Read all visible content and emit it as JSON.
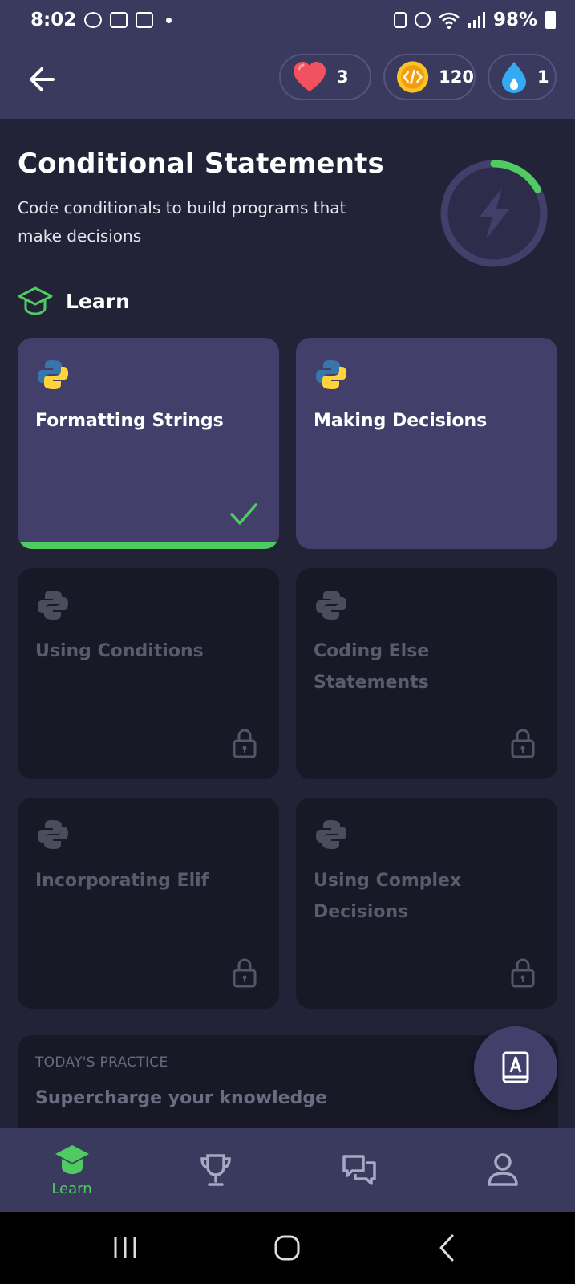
{
  "status_bar": {
    "time": "8:02",
    "battery": "98%"
  },
  "header": {
    "hearts": "3",
    "coins": "120",
    "streak": "1",
    "colors": {
      "heart": "#f2525f",
      "coin": "#f7c325",
      "streak": "#35a9f2"
    }
  },
  "course": {
    "title": "Conditional Statements",
    "description": "Code conditionals to build programs that make decisions",
    "progress_fraction": 0.17
  },
  "learn_section": {
    "label": "Learn"
  },
  "lessons": [
    {
      "title": "Formatting Strings",
      "state": "completed"
    },
    {
      "title": "Making Decisions",
      "state": "unlocked"
    },
    {
      "title": "Using Conditions",
      "state": "locked"
    },
    {
      "title": "Coding Else Statements",
      "state": "locked"
    },
    {
      "title": "Incorporating Elif",
      "state": "locked"
    },
    {
      "title": "Using Complex Decisions",
      "state": "locked"
    }
  ],
  "practice": {
    "label": "TODAY'S PRACTICE",
    "title": "Supercharge your knowledge"
  },
  "bottom_nav": {
    "items": [
      {
        "label": "Learn",
        "icon": "graduation-cap-icon",
        "active": true
      },
      {
        "label": "",
        "icon": "trophy-icon",
        "active": false
      },
      {
        "label": "",
        "icon": "chat-icon",
        "active": false
      },
      {
        "label": "",
        "icon": "profile-icon",
        "active": false
      }
    ]
  },
  "accent_color": "#4fcb62"
}
